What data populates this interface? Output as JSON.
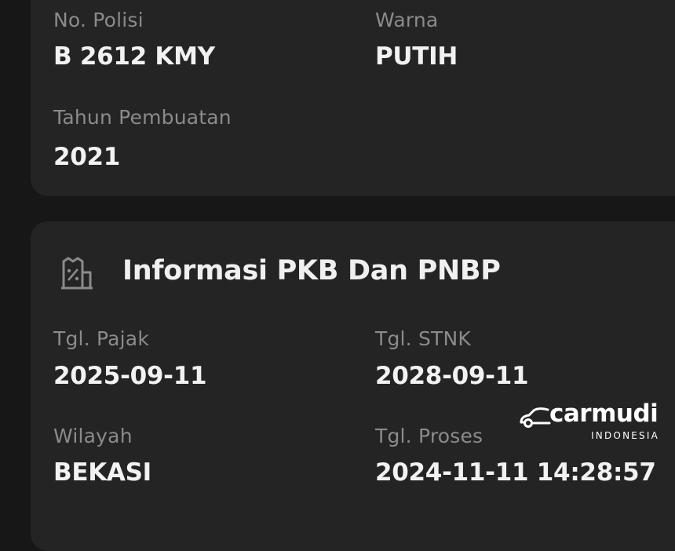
{
  "vehicle_info": {
    "plate_label": "No. Polisi",
    "plate_value": "B 2612 KMY",
    "color_label": "Warna",
    "color_value": "PUTIH",
    "year_label": "Tahun Pembuatan",
    "year_value": "2021"
  },
  "pkb_info": {
    "title": "Informasi PKB Dan PNBP",
    "icon": "tax-document-icon",
    "tax_date_label": "Tgl. Pajak",
    "tax_date_value": "2025-09-11",
    "stnk_date_label": "Tgl. STNK",
    "stnk_date_value": "2028-09-11",
    "region_label": "Wilayah",
    "region_value": "BEKASI",
    "process_date_label": "Tgl. Proses",
    "process_date_value": "2024-11-11 14:28:57"
  },
  "watermark": {
    "brand": "carmudi",
    "subtitle": "INDONESIA"
  },
  "colors": {
    "background": "#161716",
    "card": "#232423",
    "label": "#8a8b8a",
    "value": "#f2f2f2"
  }
}
